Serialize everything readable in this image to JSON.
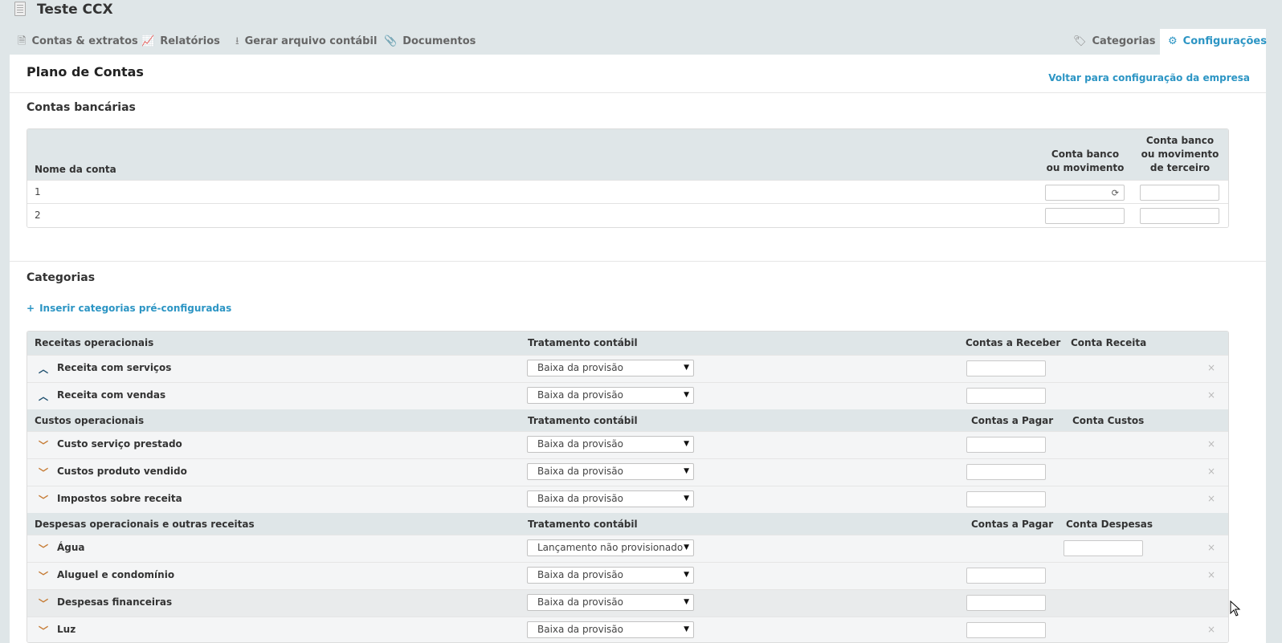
{
  "app": {
    "title": "Teste CCX",
    "icon": "building-icon"
  },
  "tabs": [
    {
      "label": "Contas & extratos",
      "icon": "document-icon"
    },
    {
      "label": "Relatórios",
      "icon": "chart-line-icon"
    },
    {
      "label": "Gerar arquivo contábil",
      "icon": "download-icon"
    },
    {
      "label": "Documentos",
      "icon": "paperclip-icon"
    },
    {
      "label": "Categorias",
      "icon": "tags-icon"
    },
    {
      "label": "Configurações",
      "icon": "gear-icon",
      "active": true
    }
  ],
  "page": {
    "title": "Plano de Contas",
    "back_link": "Voltar para configuração da empresa"
  },
  "bank_accounts": {
    "section_title": "Contas bancárias",
    "headers": {
      "name": "Nome da conta",
      "bank_line1": "Conta banco",
      "bank_line2": "ou movimento",
      "third_line1": "Conta banco",
      "third_line2": "ou movimento",
      "third_line3": "de terceiro"
    },
    "rows": [
      {
        "name": "1"
      },
      {
        "name": "2"
      }
    ]
  },
  "categories": {
    "section_title": "Categorias",
    "add_link": "Inserir categorias pré-configuradas",
    "groups": [
      {
        "title": "Receitas operacionais",
        "treatment_header": "Tratamento contábil",
        "col3_header": "Contas a Receber",
        "col4_header": "Conta Receita",
        "rows": [
          {
            "name": "Receita com serviços",
            "treatment": "Baixa da provisão",
            "chevron": "up"
          },
          {
            "name": "Receita com vendas",
            "treatment": "Baixa da provisão",
            "chevron": "up"
          }
        ]
      },
      {
        "title": "Custos operacionais",
        "treatment_header": "Tratamento contábil",
        "col3_header": "Contas a Pagar",
        "col4_header": "Conta Custos",
        "rows": [
          {
            "name": "Custo serviço prestado",
            "treatment": "Baixa da provisão",
            "chevron": "down"
          },
          {
            "name": "Custos produto vendido",
            "treatment": "Baixa da provisão",
            "chevron": "down"
          },
          {
            "name": "Impostos sobre receita",
            "treatment": "Baixa da provisão",
            "chevron": "down"
          }
        ]
      },
      {
        "title": "Despesas operacionais e outras receitas",
        "treatment_header": "Tratamento contábil",
        "col3_header": "Contas a Pagar",
        "col4_header": "Conta Despesas",
        "rows": [
          {
            "name": "Água",
            "treatment": "Lançamento não provisionado",
            "chevron": "down"
          },
          {
            "name": "Aluguel e condomínio",
            "treatment": "Baixa da provisão",
            "chevron": "down"
          },
          {
            "name": "Despesas financeiras",
            "treatment": "Baixa da provisão",
            "chevron": "down"
          },
          {
            "name": "Luz",
            "treatment": "Baixa da provisão",
            "chevron": "down"
          }
        ]
      }
    ]
  },
  "colors": {
    "accent": "#2c95c4",
    "header_bg": "#dfe6e8",
    "chevron_up": "#1e4f6e",
    "chevron_down": "#c57a33"
  }
}
